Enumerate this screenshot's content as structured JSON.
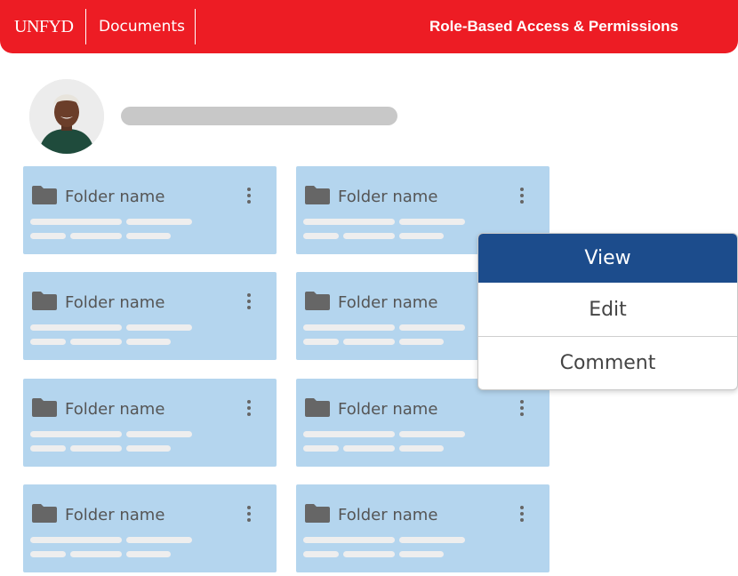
{
  "header": {
    "brand": "UNFYD",
    "section": "Documents",
    "title": "Role-Based Access & Permissions"
  },
  "colors": {
    "header_bg": "#ed1c24",
    "card_bg": "#b4d5ee",
    "menu_active": "#1c4c8c"
  },
  "folders": [
    {
      "label": "Folder name",
      "icon": "folder-icon"
    },
    {
      "label": "Folder name",
      "icon": "folder-icon"
    },
    {
      "label": "Folder name",
      "icon": "folder-icon"
    },
    {
      "label": "Folder name",
      "icon": "folder-icon"
    },
    {
      "label": "Folder name",
      "icon": "folder-icon"
    },
    {
      "label": "Folder name",
      "icon": "folder-icon"
    },
    {
      "label": "Folder name",
      "icon": "folder-icon"
    },
    {
      "label": "Folder name",
      "icon": "folder-icon"
    }
  ],
  "menu": {
    "items": [
      {
        "label": "View",
        "active": true
      },
      {
        "label": "Edit",
        "active": false
      },
      {
        "label": "Comment",
        "active": false
      }
    ]
  }
}
